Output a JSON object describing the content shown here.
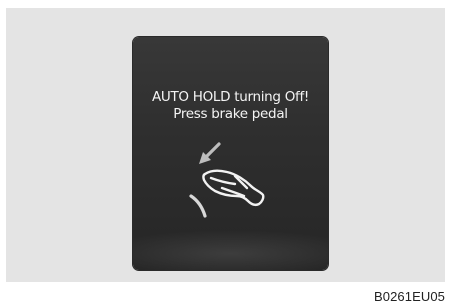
{
  "display": {
    "message_line1": "AUTO HOLD turning Off!",
    "message_line2": "Press brake pedal",
    "icon": "foot-pressing-brake-pedal-icon"
  },
  "caption": "B0261EU05",
  "colors": {
    "frame_background": "#e4e4e4",
    "screen_background": "#303030",
    "text": "#f4f4f4"
  }
}
